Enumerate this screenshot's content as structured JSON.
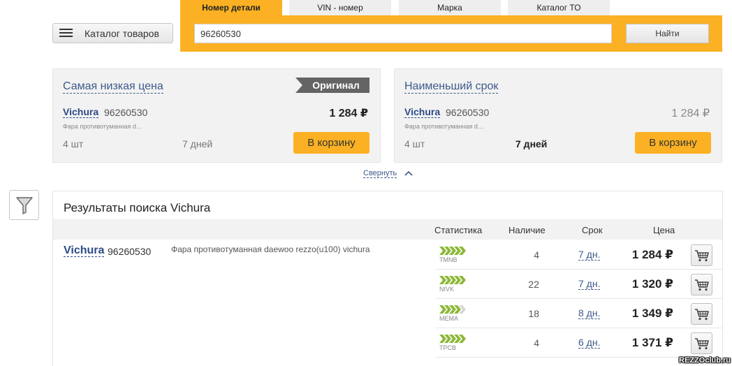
{
  "catalog_button": {
    "label": "Каталог товаров"
  },
  "search": {
    "tabs": [
      "Номер детали",
      "VIN - номер",
      "Марка",
      "Каталог ТО"
    ],
    "active_tab": 0,
    "query": "96260530",
    "button": "Найти"
  },
  "best_offers": [
    {
      "title": "Самая низкая цена",
      "badge": "Оригинал",
      "brand": "Vichura",
      "part": "96260530",
      "desc": "Фара противотуманная d…",
      "price": "1 284 ₽",
      "qty": "4 шт",
      "term": "7 дней",
      "cart": "В корзину"
    },
    {
      "title": "Наименьший срок",
      "brand": "Vichura",
      "part": "96260530",
      "desc": "Фара противотуманная d…",
      "price": "1 284 ₽",
      "qty": "4 шт",
      "term": "7 дней",
      "cart": "В корзину"
    }
  ],
  "collapse_label": "Свернуть",
  "results": {
    "title": "Результаты поиска Vichura",
    "columns": {
      "stats": "Статистика",
      "stock": "Наличие",
      "term": "Срок",
      "price": "Цена"
    },
    "item": {
      "brand": "Vichura",
      "part": "96260530",
      "desc": "Фара противотуманная daewoo rezzo(u100) vichura"
    },
    "offers": [
      {
        "supplier": "TMNB",
        "rating": 5,
        "qty": "4",
        "term": "7 дн.",
        "price": "1 284 ₽"
      },
      {
        "supplier": "NIVK",
        "rating": 5,
        "qty": "22",
        "term": "7 дн.",
        "price": "1 320 ₽"
      },
      {
        "supplier": "MEMA",
        "rating": 4,
        "qty": "18",
        "term": "8 дн.",
        "price": "1 349 ₽"
      },
      {
        "supplier": "TPCB",
        "rating": 5,
        "qty": "4",
        "term": "6 дн.",
        "price": "1 371 ₽"
      }
    ]
  },
  "watermark": "REZZOclub.ru",
  "colors": {
    "accent": "#fbb123",
    "link": "#3d5a8a",
    "rating": "#8db83a"
  }
}
